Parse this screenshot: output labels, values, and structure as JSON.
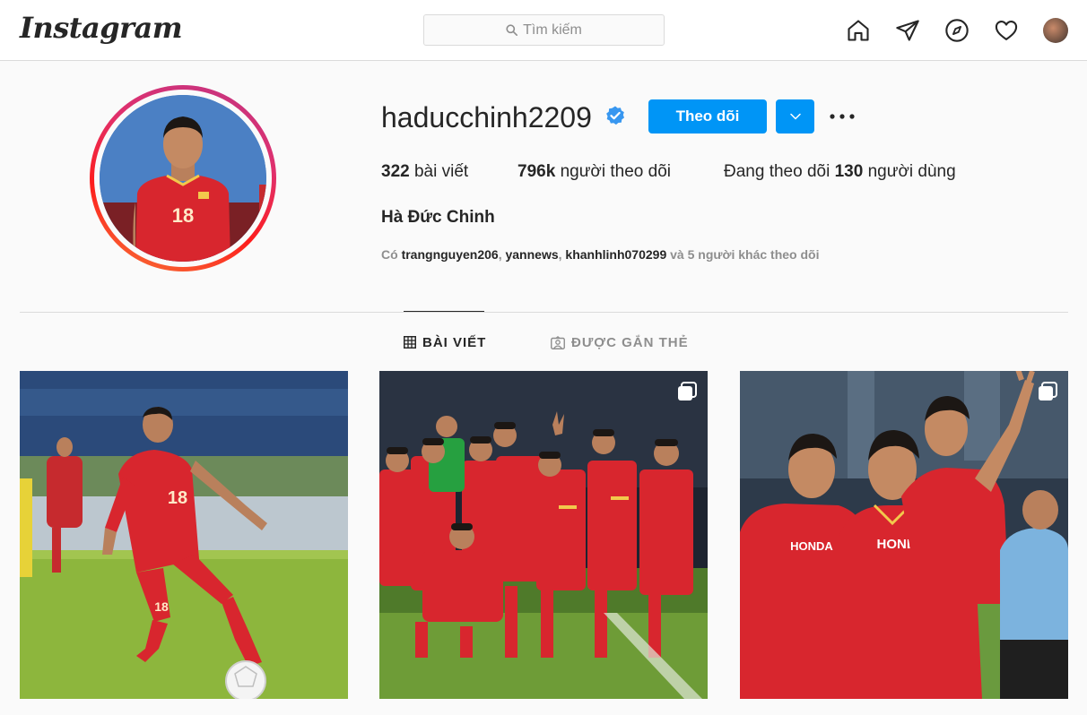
{
  "app": {
    "logo_text": "Instagram"
  },
  "search": {
    "placeholder": "Tìm kiếm"
  },
  "nav": {
    "icons": [
      "home-icon",
      "direct-message-icon",
      "explore-icon",
      "activity-heart-icon",
      "profile-avatar"
    ]
  },
  "profile": {
    "username": "haducchinh2209",
    "verified": true,
    "follow_label": "Theo dõi",
    "full_name": "Hà Đức Chinh",
    "stats": {
      "posts_count": "322",
      "posts_label": "bài viết",
      "followers_count": "796k",
      "followers_label": "người theo dõi",
      "following_prefix": "Đang theo dõi",
      "following_count": "130",
      "following_suffix": "người dùng"
    },
    "followed_by": {
      "prefix": "Có",
      "users": [
        "trangnguyen206",
        "yannews",
        "khanhlinh070299"
      ],
      "suffix": "và 5 người khác theo dõi"
    }
  },
  "tabs": [
    {
      "label": "BÀI VIẾT",
      "icon": "grid-icon",
      "active": true
    },
    {
      "label": "ĐƯỢC GẮN THẺ",
      "icon": "tagged-icon",
      "active": false
    }
  ],
  "posts": [
    {
      "multiple": false,
      "jersey_number": "18"
    },
    {
      "multiple": true
    },
    {
      "multiple": true,
      "jersey_text": "HONDA"
    }
  ],
  "colors": {
    "accent": "#0095f6",
    "text": "#262626",
    "muted": "#8e8e8e",
    "border": "#dbdbdb",
    "jersey": "#d8262e"
  }
}
